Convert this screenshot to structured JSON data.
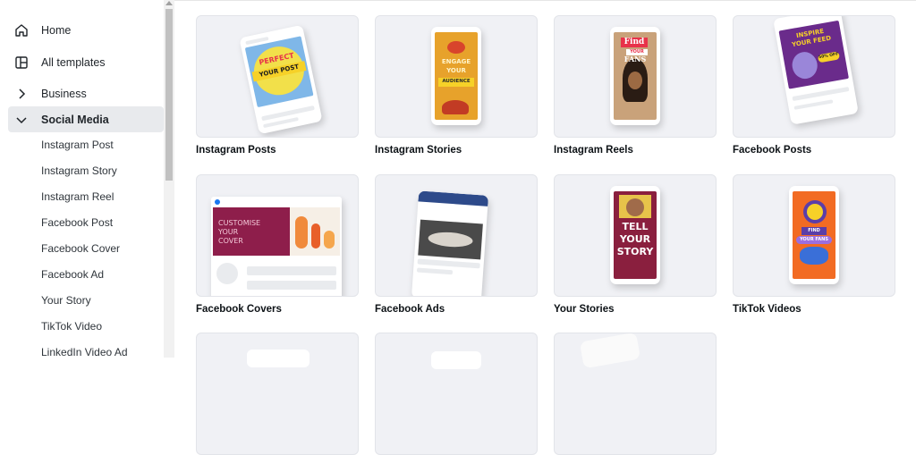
{
  "sidebar": {
    "home": "Home",
    "all_templates": "All templates",
    "business": "Business",
    "social_media": "Social Media",
    "sub_items": [
      "Instagram Post",
      "Instagram Story",
      "Instagram Reel",
      "Facebook Post",
      "Facebook Cover",
      "Facebook Ad",
      "Your Story",
      "TikTok Video",
      "LinkedIn Video Ad"
    ]
  },
  "cards": [
    {
      "label": "Instagram Posts",
      "thumb_text": [
        "PERFECT",
        "YOUR POST"
      ]
    },
    {
      "label": "Instagram Stories",
      "thumb_text": [
        "ENGAGE",
        "YOUR",
        "AUDIENCE"
      ]
    },
    {
      "label": "Instagram Reels",
      "thumb_text": [
        "Find",
        "YOUR",
        "FANS"
      ]
    },
    {
      "label": "Facebook Posts",
      "thumb_text": [
        "INSPIRE",
        "YOUR FEED",
        "50% OFF"
      ]
    },
    {
      "label": "Facebook Covers",
      "thumb_text": [
        "CUSTOMISE",
        "YOUR",
        "COVER"
      ]
    },
    {
      "label": "Facebook Ads",
      "thumb_text": []
    },
    {
      "label": "Your Stories",
      "thumb_text": [
        "TELL",
        "YOUR",
        "STORY"
      ]
    },
    {
      "label": "TikTok Videos",
      "thumb_text": [
        "FIND",
        "YOUR FANS"
      ]
    }
  ],
  "colors": {
    "active_bg": "#e8eaed",
    "thumb_bg": "#f0f1f5",
    "accent_yellow": "#f5d31f",
    "accent_orange": "#f26b23",
    "accent_purple": "#6e2c8c",
    "accent_maroon": "#8e1e4b"
  }
}
